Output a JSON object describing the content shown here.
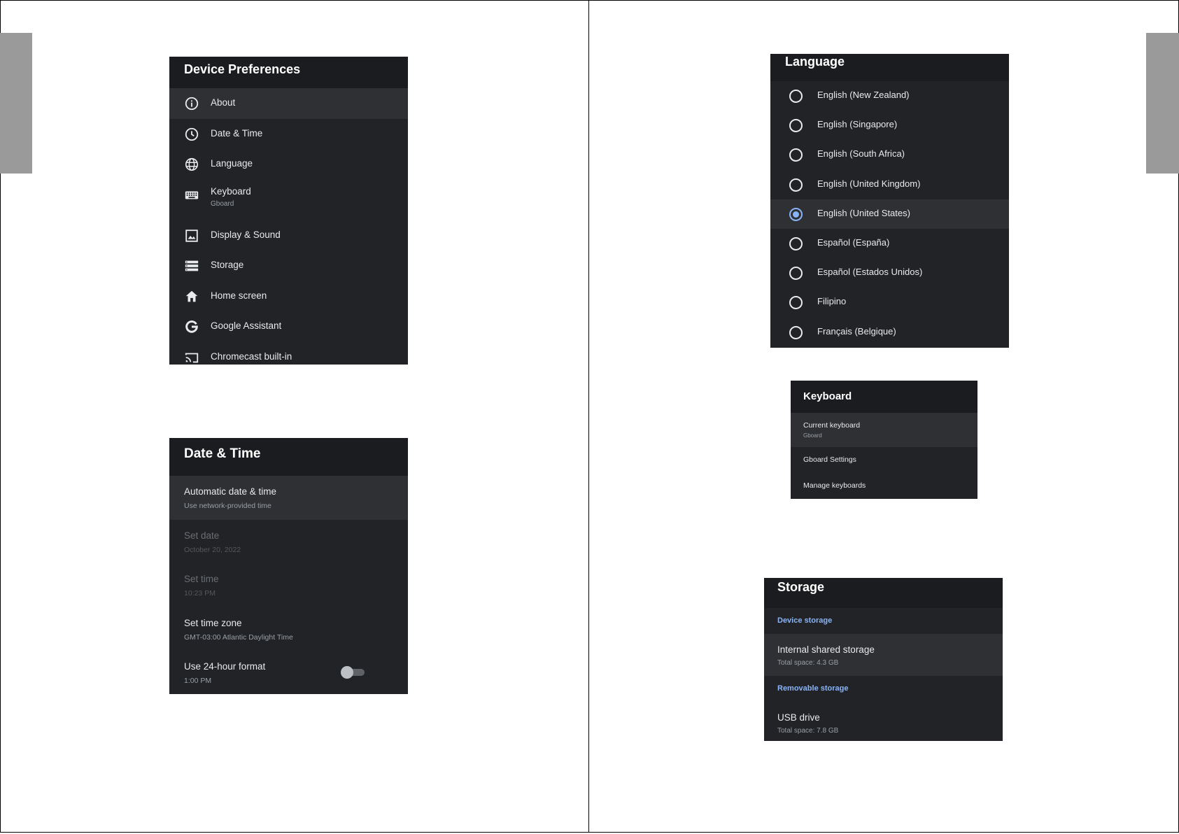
{
  "device_preferences": {
    "title": "Device Preferences",
    "items": [
      {
        "label": "About",
        "sub": "",
        "icon": "info-icon"
      },
      {
        "label": "Date & Time",
        "sub": "",
        "icon": "clock-icon"
      },
      {
        "label": "Language",
        "sub": "",
        "icon": "globe-icon"
      },
      {
        "label": "Keyboard",
        "sub": "Gboard",
        "icon": "keyboard-icon"
      },
      {
        "label": "Display & Sound",
        "sub": "",
        "icon": "image-icon"
      },
      {
        "label": "Storage",
        "sub": "",
        "icon": "storage-icon"
      },
      {
        "label": "Home screen",
        "sub": "",
        "icon": "home-icon"
      },
      {
        "label": "Google Assistant",
        "sub": "",
        "icon": "google-icon"
      },
      {
        "label": "Chromecast built-in",
        "sub": "",
        "icon": "cast-icon"
      }
    ]
  },
  "date_time": {
    "title": "Date & Time",
    "items": [
      {
        "label": "Automatic date & time",
        "sub": "Use network-provided time"
      },
      {
        "label": "Set date",
        "sub": "October 20, 2022"
      },
      {
        "label": "Set time",
        "sub": "10:23 PM"
      },
      {
        "label": "Set time zone",
        "sub": "GMT-03:00 Atlantic Daylight Time"
      },
      {
        "label": "Use 24-hour format",
        "sub": "1:00 PM"
      }
    ]
  },
  "language": {
    "title": "Language",
    "options": [
      "English (New Zealand)",
      "English (Singapore)",
      "English (South Africa)",
      "English (United Kingdom)",
      "English (United States)",
      "Español (España)",
      "Español (Estados Unidos)",
      "Filipino",
      "Français (Belgique)"
    ],
    "selected": "English (United States)"
  },
  "keyboard": {
    "title": "Keyboard",
    "items": [
      {
        "label": "Current keyboard",
        "sub": "Gboard"
      },
      {
        "label": "Gboard Settings",
        "sub": ""
      },
      {
        "label": "Manage keyboards",
        "sub": ""
      }
    ]
  },
  "storage": {
    "title": "Storage",
    "device_section": "Device storage",
    "internal": {
      "label": "Internal shared storage",
      "sub": "Total space: 4.3 GB"
    },
    "removable_section": "Removable storage",
    "usb": {
      "label": "USB drive",
      "sub": "Total space: 7.8 GB"
    }
  },
  "colors": {
    "panel": "#212326",
    "header": "#1b1c1f",
    "accent": "#8ab4f8"
  }
}
